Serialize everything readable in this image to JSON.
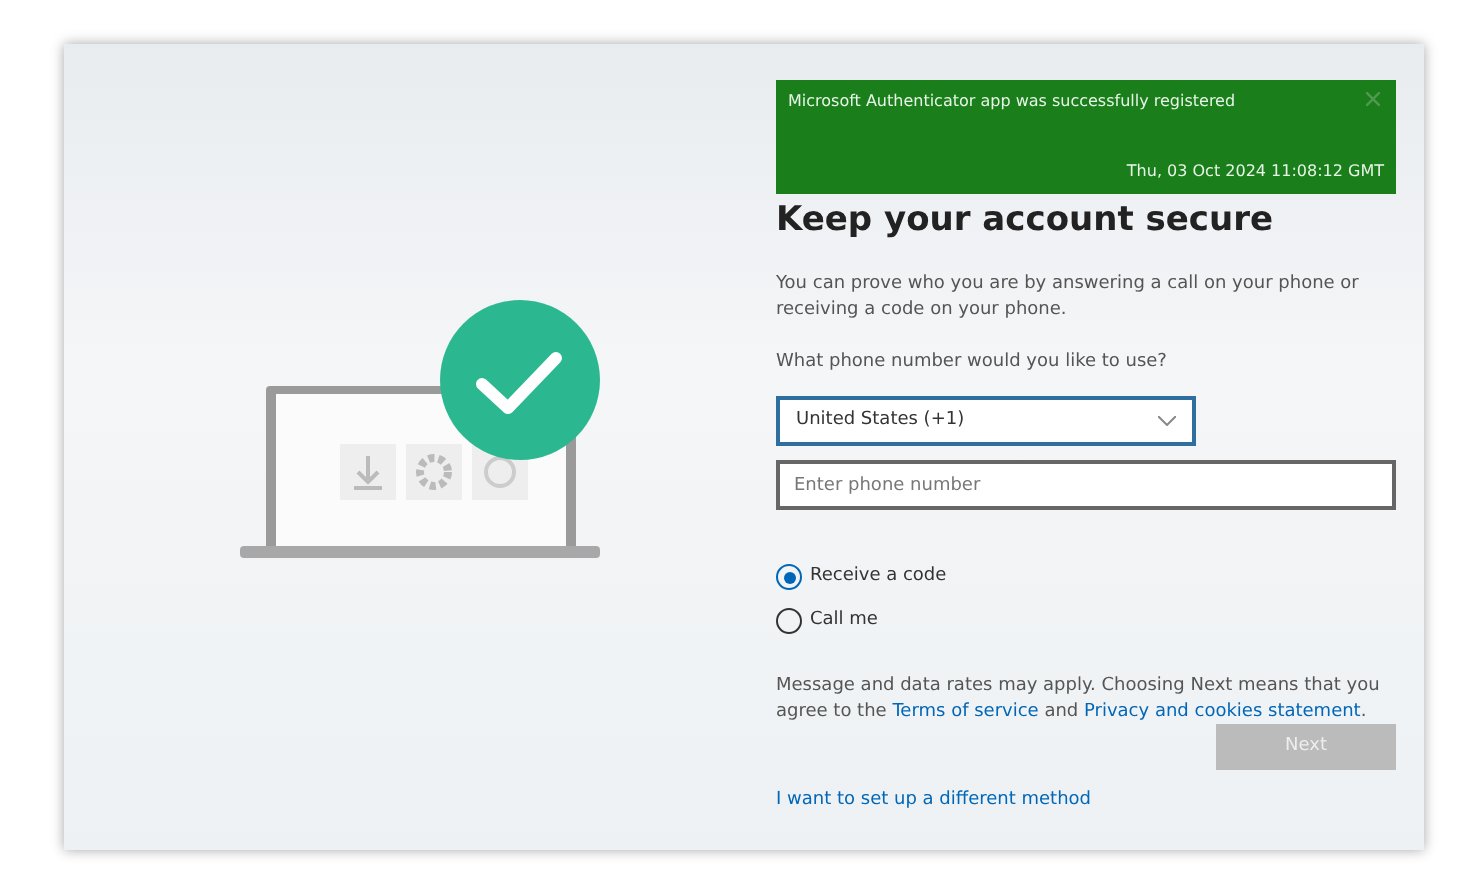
{
  "toast": {
    "message": "Microsoft Authenticator app was successfully registered",
    "timestamp": "Thu, 03 Oct 2024 11:08:12 GMT"
  },
  "heading": "Keep your account secure",
  "description": "You can prove who you are by answering a call on your phone or receiving a code on your phone.",
  "question": "What phone number would you like to use?",
  "country_select": {
    "value": "United States (+1)"
  },
  "phone_field": {
    "placeholder": "Enter phone number"
  },
  "options": [
    {
      "label": "Receive a code",
      "selected": true
    },
    {
      "label": "Call me",
      "selected": false
    }
  ],
  "terms": {
    "text_before": "Message and data rates may apply. Choosing Next means that you agree to the",
    "link_1": "Terms of service",
    "text_middle": "and",
    "link_2": "Privacy and cookies statement",
    "text_after": "."
  },
  "next_button": {
    "label": "Next",
    "disabled": true
  },
  "alternate_link": "I want to set up a different method"
}
